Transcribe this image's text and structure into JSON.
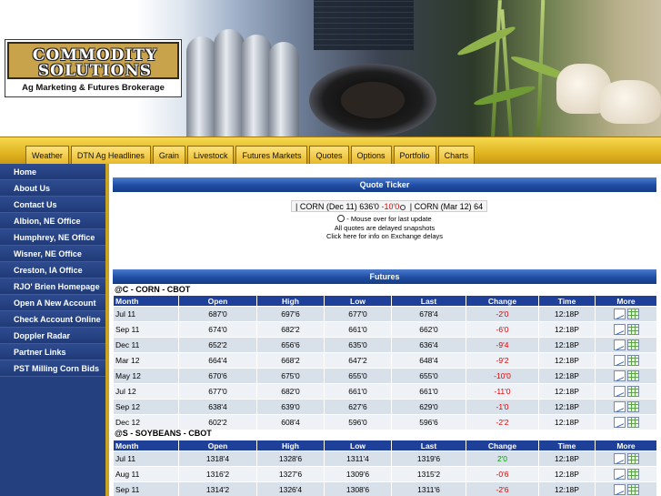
{
  "logo": {
    "line1": "COMMODITY",
    "line2": "SOLUTIONS",
    "tagline": "Ag Marketing & Futures Brokerage"
  },
  "nav": [
    "Weather",
    "DTN Ag Headlines",
    "Grain",
    "Livestock",
    "Futures Markets",
    "Quotes",
    "Options",
    "Portfolio",
    "Charts"
  ],
  "sidebar": [
    "Home",
    "About Us",
    "Contact Us",
    "Albion, NE Office",
    "Humphrey, NE Office",
    "Wisner, NE Office",
    "Creston, IA Office",
    "RJO' Brien Homepage",
    "Open A New Account",
    "Check Account Online",
    "Doppler Radar",
    "Partner Links",
    "PST Milling Corn Bids"
  ],
  "ticker": {
    "title": "Quote Ticker",
    "sep": "|",
    "item1_label": "CORN (Dec 11) 636'0",
    "item1_change": "-10'0",
    "item2_label": "CORN (Mar 12) 64",
    "note1": "- Mouse over for last update",
    "note2": "All quotes are delayed snapshots",
    "note3": "Click here for info on Exchange delays"
  },
  "futures": {
    "title": "Futures",
    "columns": [
      "Month",
      "Open",
      "High",
      "Low",
      "Last",
      "Change",
      "Time",
      "More"
    ],
    "markets": [
      {
        "title": "@C - CORN - CBOT",
        "rows": [
          [
            "Jul 11",
            "687'0",
            "697'6",
            "677'0",
            "678'4",
            "-2'0",
            "12:18P"
          ],
          [
            "Sep 11",
            "674'0",
            "682'2",
            "661'0",
            "662'0",
            "-6'0",
            "12:18P"
          ],
          [
            "Dec 11",
            "652'2",
            "656'6",
            "635'0",
            "636'4",
            "-9'4",
            "12:18P"
          ],
          [
            "Mar 12",
            "664'4",
            "668'2",
            "647'2",
            "648'4",
            "-9'2",
            "12:18P"
          ],
          [
            "May 12",
            "670'6",
            "675'0",
            "655'0",
            "655'0",
            "-10'0",
            "12:18P"
          ],
          [
            "Jul 12",
            "677'0",
            "682'0",
            "661'0",
            "661'0",
            "-11'0",
            "12:18P"
          ],
          [
            "Sep 12",
            "638'4",
            "639'0",
            "627'6",
            "629'0",
            "-1'0",
            "12:18P"
          ],
          [
            "Dec 12",
            "602'2",
            "608'4",
            "596'0",
            "596'6",
            "-2'2",
            "12:18P"
          ]
        ]
      },
      {
        "title": "@S - SOYBEANS - CBOT",
        "rows": [
          [
            "Jul 11",
            "1318'4",
            "1328'6",
            "1311'4",
            "1319'6",
            "2'0",
            "12:18P"
          ],
          [
            "Aug 11",
            "1316'2",
            "1327'6",
            "1309'6",
            "1315'2",
            "-0'6",
            "12:18P"
          ],
          [
            "Sep 11",
            "1314'2",
            "1326'4",
            "1308'6",
            "1311'6",
            "-2'6",
            "12:18P"
          ]
        ]
      }
    ]
  },
  "colors": {
    "nav_gold": "#e0b421",
    "sidebar_blue": "#25407f",
    "header_blue": "#1f4098",
    "negative": "#e00000",
    "positive": "#0a9a0a"
  },
  "icons": [
    "line-chart-icon",
    "table-chart-icon",
    "clock-icon"
  ]
}
